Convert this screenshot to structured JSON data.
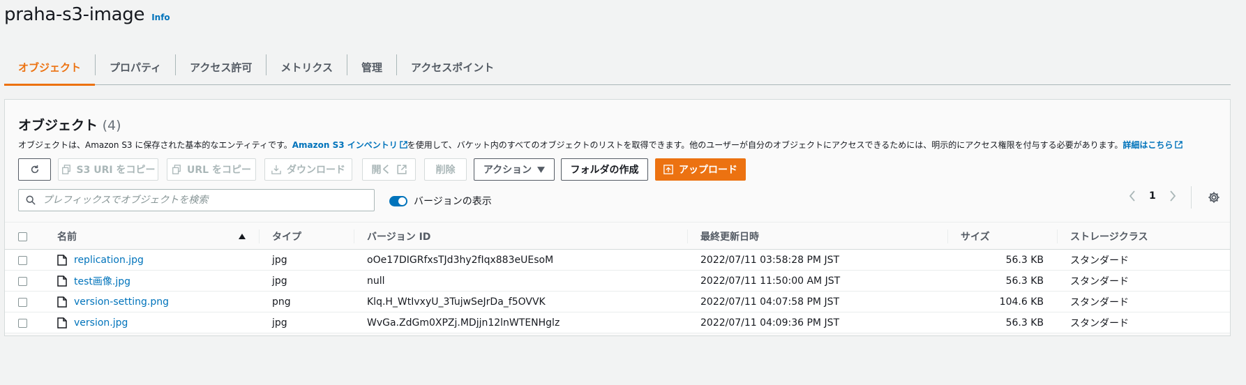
{
  "bucket": {
    "name": "praha-s3-image",
    "info": "Info"
  },
  "tabs": [
    {
      "label": "オブジェクト",
      "active": true
    },
    {
      "label": "プロパティ"
    },
    {
      "label": "アクセス許可"
    },
    {
      "label": "メトリクス"
    },
    {
      "label": "管理"
    },
    {
      "label": "アクセスポイント"
    }
  ],
  "panel": {
    "title": "オブジェクト",
    "count": "(4)",
    "desc_part1": "オブジェクトは、Amazon S3 に保存された基本的なエンティティです。",
    "desc_link1": "Amazon S3 インベントリ",
    "desc_part2": "を使用して、バケット内のすべてのオブジェクトのリストを取得できます。他のユーザーが自分のオブジェクトにアクセスできるためには、明示的にアクセス権限を付与する必要があります。",
    "desc_link2": "詳細はこちら"
  },
  "toolbar": {
    "copy_s3_uri": "S3 URI をコピー",
    "copy_url": "URL をコピー",
    "download": "ダウンロード",
    "open": "開く",
    "delete": "削除",
    "actions": "アクション",
    "create_folder": "フォルダの作成",
    "upload": "アップロード"
  },
  "search": {
    "placeholder": "プレフィックスでオブジェクトを検索"
  },
  "versions_toggle": {
    "label": "バージョンの表示",
    "on": true
  },
  "pagination": {
    "page": "1"
  },
  "table": {
    "columns": [
      "名前",
      "タイプ",
      "バージョン ID",
      "最終更新日時",
      "サイズ",
      "ストレージクラス"
    ],
    "rows": [
      {
        "name": "replication.jpg",
        "type": "jpg",
        "version": "oOe17DIGRfxsTJd3hy2fIqx883eUEsoM",
        "modified": "2022/07/11 03:58:28 PM JST",
        "size": "56.3 KB",
        "storage": "スタンダード"
      },
      {
        "name": "test画像.jpg",
        "type": "jpg",
        "version": "null",
        "modified": "2022/07/11 11:50:00 AM JST",
        "size": "56.3 KB",
        "storage": "スタンダード"
      },
      {
        "name": "version-setting.png",
        "type": "png",
        "version": "Klq.H_WtIvxyU_3TujwSeJrDa_f5OVVK",
        "modified": "2022/07/11 04:07:58 PM JST",
        "size": "104.6 KB",
        "storage": "スタンダード"
      },
      {
        "name": "version.jpg",
        "type": "jpg",
        "version": "WvGa.ZdGm0XPZj.MDjjn12lnWTENHglz",
        "modified": "2022/07/11 04:09:36 PM JST",
        "size": "56.3 KB",
        "storage": "スタンダード"
      }
    ]
  },
  "colors": {
    "accent": "#ec7211",
    "link": "#0073bb"
  }
}
